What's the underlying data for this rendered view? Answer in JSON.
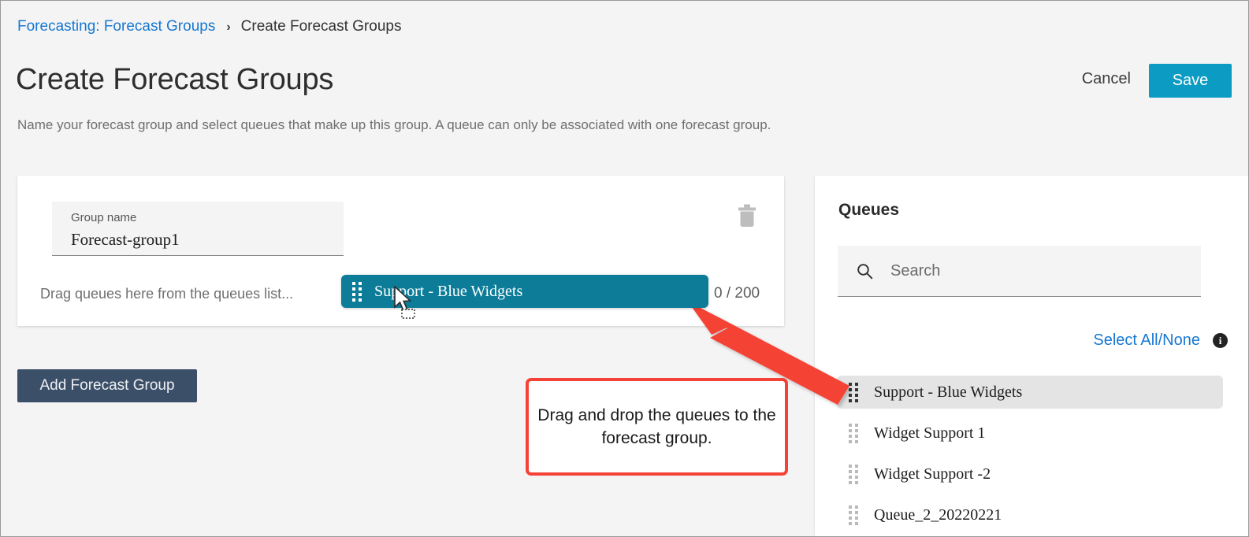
{
  "breadcrumb": {
    "parent": "Forecasting: Forecast Groups",
    "separator": "›",
    "current": "Create Forecast Groups"
  },
  "header": {
    "title": "Create Forecast Groups",
    "subtitle": "Name your forecast group and select queues that make up this group. A queue can only be associated with one forecast group.",
    "cancel_label": "Cancel",
    "save_label": "Save"
  },
  "group_card": {
    "name_label": "Group name",
    "name_value": "Forecast-group1",
    "drop_hint": "Drag queues here from the queues list...",
    "counter": "0 / 200",
    "delete_icon": "trash-icon"
  },
  "dragged_item": {
    "label": "Support - Blue Widgets",
    "handle_icon": "drag-handle-icon"
  },
  "actions": {
    "add_group_label": "Add Forecast Group"
  },
  "queues_panel": {
    "title": "Queues",
    "search_placeholder": "Search",
    "search_value": "",
    "search_icon": "search-icon",
    "select_all_label": "Select All/None",
    "info_icon": "info-icon",
    "info_glyph": "i",
    "items": [
      {
        "label": "Support - Blue Widgets",
        "selected": true
      },
      {
        "label": "Widget Support 1",
        "selected": false
      },
      {
        "label": "Widget Support -2",
        "selected": false
      },
      {
        "label": "Queue_2_20220221",
        "selected": false
      }
    ]
  },
  "annotation": {
    "callout_text": "Drag and drop the queues to the forecast group.",
    "accent_color": "#f44336"
  },
  "colors": {
    "link": "#1878d2",
    "save_button": "#0b9bc3",
    "chip_teal": "#0c7c99",
    "add_button": "#3c4f68",
    "page_background": "#f4f4f4",
    "annotation_red": "#f44336"
  }
}
